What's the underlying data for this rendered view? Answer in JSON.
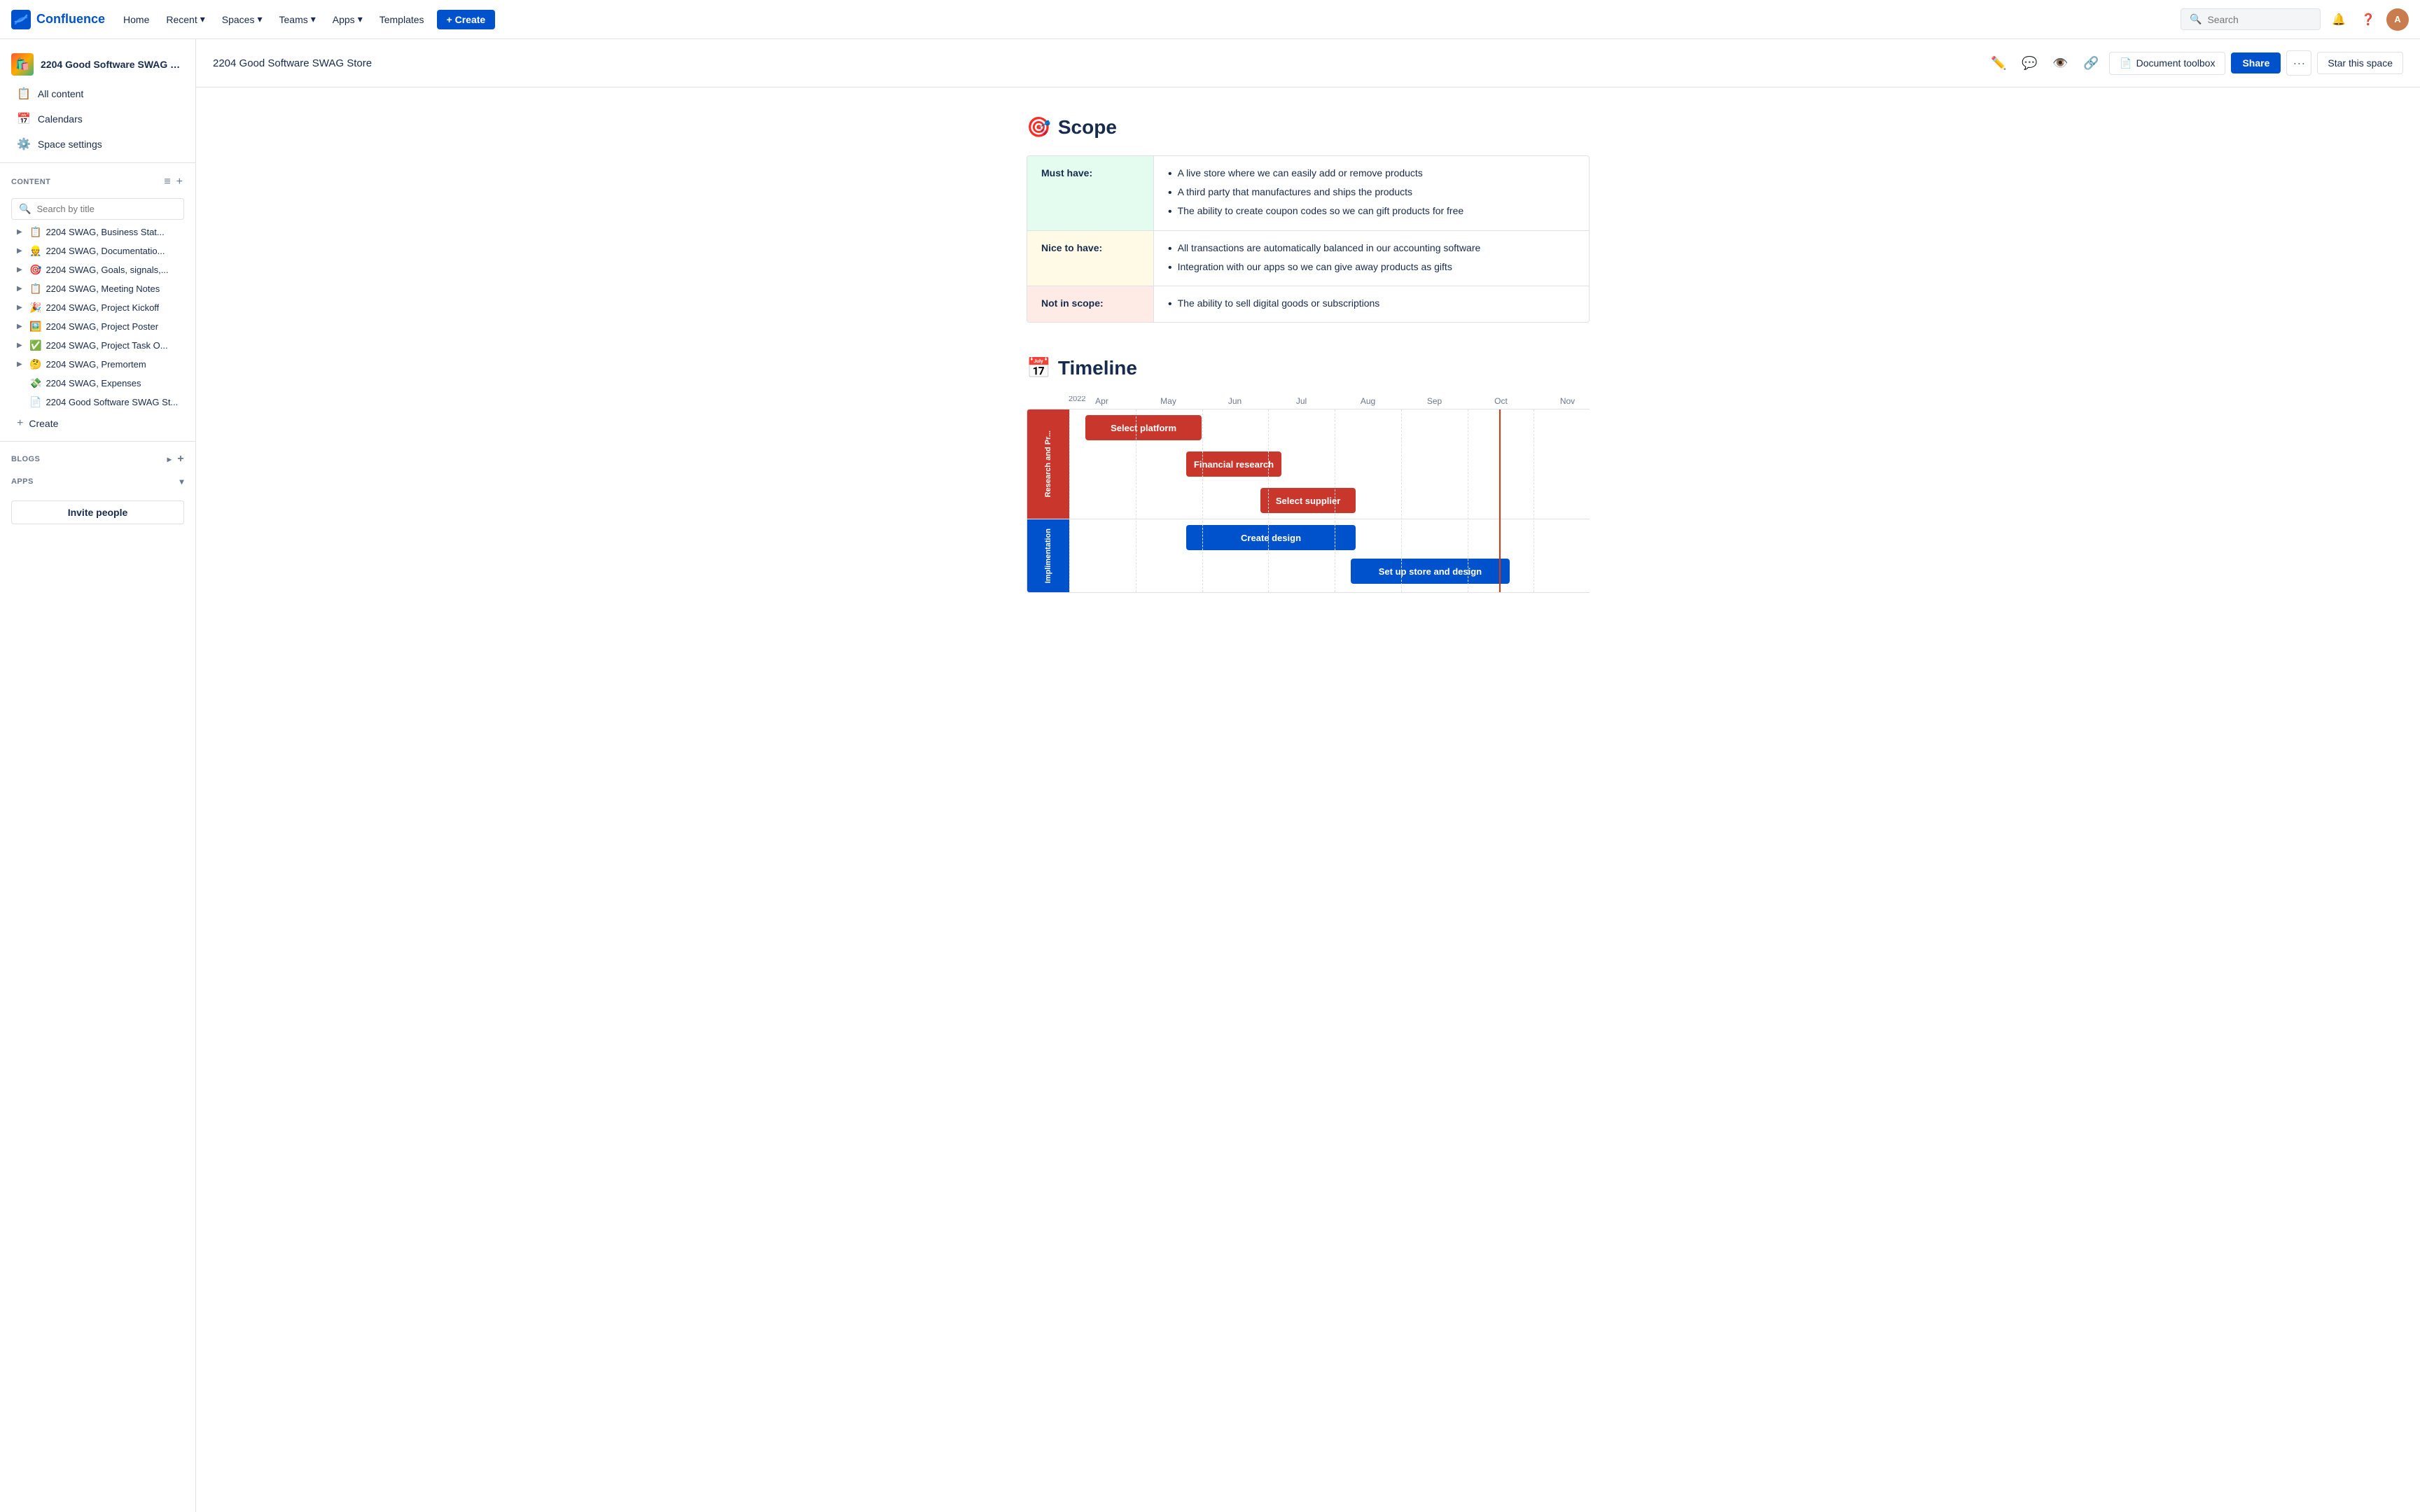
{
  "topnav": {
    "logo_text": "Confluence",
    "nav_items": [
      {
        "label": "Home",
        "id": "home"
      },
      {
        "label": "Recent",
        "id": "recent",
        "has_dropdown": true
      },
      {
        "label": "Spaces",
        "id": "spaces",
        "has_dropdown": true
      },
      {
        "label": "Teams",
        "id": "teams",
        "has_dropdown": true
      },
      {
        "label": "Apps",
        "id": "apps",
        "has_dropdown": true
      },
      {
        "label": "Templates",
        "id": "templates"
      }
    ],
    "create_label": "+ Create",
    "search_placeholder": "Search"
  },
  "sidebar": {
    "space_name": "2204 Good Software SWAG St...",
    "nav_items": [
      {
        "icon": "📋",
        "label": "All content"
      },
      {
        "icon": "📅",
        "label": "Calendars"
      },
      {
        "icon": "⚙️",
        "label": "Space settings"
      }
    ],
    "content_section_label": "CONTENT",
    "search_placeholder": "Search by title",
    "tree_items": [
      {
        "icon": "📋",
        "label": "2204 SWAG, Business Stat...",
        "has_children": true
      },
      {
        "icon": "👷",
        "label": "2204 SWAG, Documentatio...",
        "has_children": true
      },
      {
        "icon": "🎯",
        "label": "2204 SWAG, Goals, signals,...",
        "has_children": true
      },
      {
        "icon": "📋",
        "label": "2204 SWAG, Meeting Notes",
        "has_children": true
      },
      {
        "icon": "🎉",
        "label": "2204 SWAG, Project Kickoff",
        "has_children": true
      },
      {
        "icon": "🖼️",
        "label": "2204 SWAG, Project Poster",
        "has_children": true
      },
      {
        "icon": "✅",
        "label": "2204 SWAG, Project Task O...",
        "has_children": true
      },
      {
        "icon": "🤔",
        "label": "2204 SWAG, Premortem",
        "has_children": true
      },
      {
        "icon": "💸",
        "label": "2204 SWAG, Expenses",
        "has_children": false
      },
      {
        "icon": "📄",
        "label": "2204 Good Software SWAG St...",
        "has_children": false
      }
    ],
    "create_label": "Create",
    "blogs_label": "BLOGS",
    "apps_label": "APPS",
    "invite_label": "Invite people"
  },
  "page_header": {
    "breadcrumb": "2204 Good Software SWAG Store",
    "share_label": "Share",
    "star_label": "Star this space",
    "doc_toolbox_label": "Document toolbox"
  },
  "scope_section": {
    "heading": "Scope",
    "icon": "🎯",
    "rows": [
      {
        "type": "must-have",
        "label": "Must have:",
        "items": [
          "A live store where we can easily add or remove products",
          "A third party that manufactures and ships the products",
          "The ability to create coupon codes so we can gift products for free"
        ]
      },
      {
        "type": "nice-to-have",
        "label": "Nice to have:",
        "items": [
          "All transactions are automatically balanced in our accounting software",
          "Integration with our apps so we can give away products as gifts"
        ]
      },
      {
        "type": "not-in-scope",
        "label": "Not in scope:",
        "items": [
          "The ability to sell digital goods or subscriptions"
        ]
      }
    ]
  },
  "timeline_section": {
    "heading": "Timeline",
    "icon": "📅",
    "year": "2022",
    "months": [
      "Apr",
      "May",
      "Jun",
      "Jul",
      "Aug",
      "Sep",
      "Oct",
      "Nov"
    ],
    "today_line_label": "Oct",
    "lanes": [
      {
        "label": "Research and Pr...",
        "color": "red",
        "bars": [
          {
            "label": "Select platform",
            "start_pct": 5,
            "width_pct": 22,
            "color": "red"
          },
          {
            "label": "Financial research",
            "start_pct": 22,
            "width_pct": 18,
            "color": "red"
          },
          {
            "label": "Select supplier",
            "start_pct": 35,
            "width_pct": 18,
            "color": "red"
          }
        ]
      },
      {
        "label": "Implimentation",
        "color": "blue",
        "bars": [
          {
            "label": "Create design",
            "start_pct": 22,
            "width_pct": 30,
            "color": "blue"
          },
          {
            "label": "Set up store and design",
            "start_pct": 52,
            "width_pct": 28,
            "color": "blue"
          }
        ]
      }
    ]
  }
}
